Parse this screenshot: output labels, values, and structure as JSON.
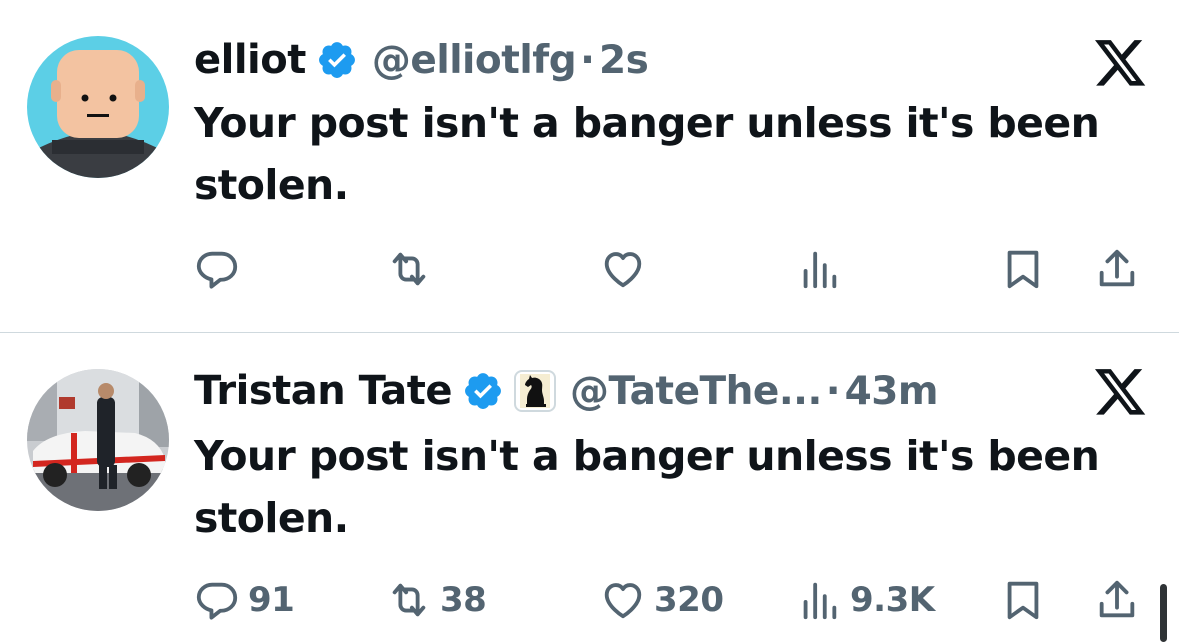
{
  "posts": [
    {
      "name": "elliot",
      "handle": "@elliotlfg",
      "separator": "·",
      "time": "2s",
      "text": "Your post isn't a banger unless it's been stolen.",
      "verified": true,
      "affiliate_badge": false,
      "avatar": "cartoon-bald-head-avatar",
      "counts": {
        "replies": "",
        "reposts": "",
        "likes": "",
        "views": ""
      }
    },
    {
      "name": "Tristan Tate",
      "handle": "@TateThe...",
      "separator": "·",
      "time": "43m",
      "text": "Your post isn't a banger unless it's been stolen.",
      "verified": true,
      "affiliate_badge": true,
      "avatar": "man-with-classic-car-photo-avatar",
      "counts": {
        "replies": "91",
        "reposts": "38",
        "likes": "320",
        "views": "9.3K"
      }
    }
  ],
  "icons": {
    "verified": "verified-badge-icon",
    "affiliate": "chess-knight-icon",
    "close": "x-logo-icon",
    "reply": "reply-icon",
    "repost": "repost-icon",
    "like": "heart-icon",
    "views": "views-icon",
    "bookmark": "bookmark-icon",
    "share": "share-icon"
  },
  "colors": {
    "text_primary": "#0f1419",
    "text_secondary": "#536471",
    "verified_blue": "#1d9bf0",
    "divider": "#cfd9de",
    "background": "#ffffff"
  }
}
